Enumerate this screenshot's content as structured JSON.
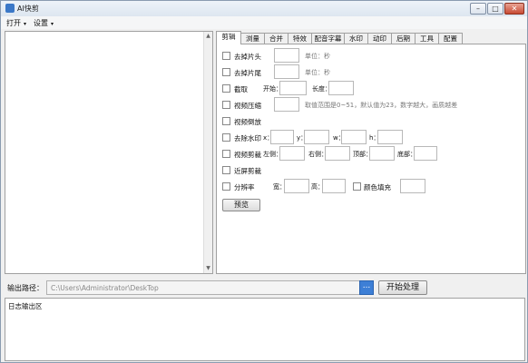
{
  "window": {
    "title": "AI快剪",
    "min_label": "–",
    "max_label": "□",
    "close_label": "✕"
  },
  "menubar": {
    "items": [
      {
        "label": "打开",
        "arrow": "▾"
      },
      {
        "label": "设置",
        "arrow": "▾"
      }
    ]
  },
  "scrollbar": {
    "up": "▲",
    "down": "▼"
  },
  "tabs": [
    {
      "label": "剪辑",
      "active": true
    },
    {
      "label": "浏量"
    },
    {
      "label": "合并"
    },
    {
      "label": "特效"
    },
    {
      "label": "配音字幕"
    },
    {
      "label": "水印"
    },
    {
      "label": "动印"
    },
    {
      "label": "后期"
    },
    {
      "label": "工具"
    },
    {
      "label": "配置"
    }
  ],
  "edit_tab": {
    "remove_head": {
      "label": "去掉片头",
      "unit": "单位：秒",
      "value": ""
    },
    "remove_tail": {
      "label": "去掉片尾",
      "unit": "单位：秒",
      "value": ""
    },
    "clip": {
      "label": "截取",
      "start_label": "开始：",
      "length_label": "长度："
    },
    "compress": {
      "label": "视频压缩",
      "hint": "取值范围是0~51，默认值为23，数字越大，画质越差"
    },
    "reverse": {
      "label": "视频倒放"
    },
    "remove_watermark": {
      "label": "去除水印",
      "x_label": "x：",
      "y_label": "y：",
      "w_label": "w：",
      "h_label": "h："
    },
    "crop": {
      "label": "视频剪裁",
      "left_label": "左侧：",
      "right_label": "右侧：",
      "top_label": "顶部：",
      "bottom_label": "底部："
    },
    "fullscreen_crop": {
      "label": "近屏剪裁"
    },
    "resolution": {
      "label": "分辨率",
      "width_label": "宽：",
      "height_label": "高：",
      "color_fill_label": "颜色填充"
    },
    "preview_button": "预览"
  },
  "output": {
    "label": "输出路径：",
    "path": "C:\\Users\\Administrator\\DeskTop",
    "browse_label": "...",
    "start_button": "开始处理"
  },
  "log": {
    "label": "日志输出区"
  }
}
